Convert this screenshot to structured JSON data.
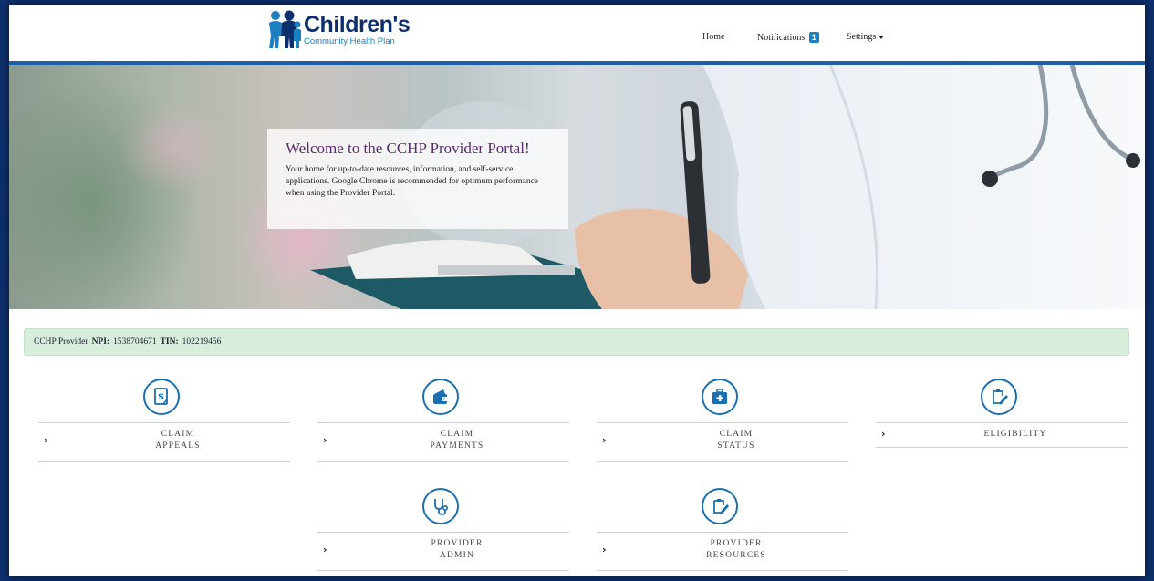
{
  "header": {
    "logo_main": "Children's",
    "logo_sub": "Community Health Plan",
    "nav": {
      "home": "Home",
      "notifications": "Notifications",
      "notifications_count": "1",
      "settings": "Settings"
    }
  },
  "hero": {
    "title": "Welcome to the CCHP Provider Portal!",
    "text": "Your home for up-to-date resources, information, and self-service applications. Google Chrome is recommended for optimum performance when using the Provider Portal."
  },
  "provider": {
    "name": "CCHP Provider",
    "npi_label": "NPI:",
    "npi": "1538704671",
    "tin_label": "TIN:",
    "tin": "102219456"
  },
  "tiles": [
    {
      "line1": "CLAIM",
      "line2": "APPEALS",
      "icon": "dollar-document-icon"
    },
    {
      "line1": "CLAIM",
      "line2": "PAYMENTS",
      "icon": "wallet-icon"
    },
    {
      "line1": "CLAIM",
      "line2": "STATUS",
      "icon": "medical-kit-icon"
    },
    {
      "line1": "ELIGIBILITY",
      "line2": "",
      "icon": "clipboard-edit-icon"
    },
    {
      "line1": "PROVIDER",
      "line2": "ADMIN",
      "icon": "stethoscope-icon"
    },
    {
      "line1": "PROVIDER",
      "line2": "RESOURCES",
      "icon": "clipboard-edit-icon"
    }
  ],
  "colors": {
    "brand_navy": "#0d2f6b",
    "brand_blue": "#1b7fc0",
    "accent_line": "#1f5fa6",
    "title_purple": "#5a2a73",
    "info_green": "#d8eedc"
  }
}
